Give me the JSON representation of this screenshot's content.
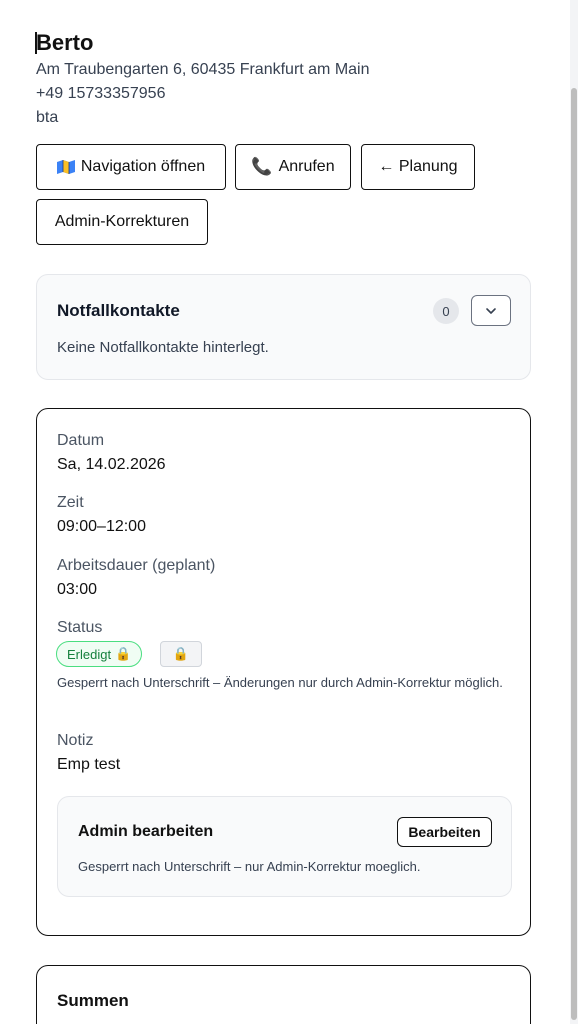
{
  "customer": {
    "name": "Berto",
    "address": "Am Traubengarten 6, 60435 Frankfurt am Main",
    "phone": "+49 15733357956",
    "code": "bta"
  },
  "actions": {
    "navigation_label": "Navigation öffnen",
    "call_label": "Anrufen",
    "planning_label": "← Planung",
    "admin_corrections_label": "Admin-Korrekturen"
  },
  "emergency": {
    "title": "Notfallkontakte",
    "count": "0",
    "empty_text": "Keine Notfallkontakte hinterlegt."
  },
  "details": {
    "date_label": "Datum",
    "date_value": "Sa, 14.02.2026",
    "time_label": "Zeit",
    "time_value": "09:00–12:00",
    "duration_label": "Arbeitsdauer (geplant)",
    "duration_value": "03:00",
    "status_label": "Status",
    "status_value": "Erledigt",
    "lock_note": "Gesperrt nach Unterschrift – Änderungen nur durch Admin-Korrektur möglich.",
    "note_label": "Notiz",
    "note_value": "Emp test"
  },
  "admin_edit": {
    "title": "Admin bearbeiten",
    "button_label": "Bearbeiten",
    "note": "Gesperrt nach Unterschrift – nur Admin-Korrektur moeglich."
  },
  "summary": {
    "title": "Summen"
  },
  "icons": {
    "navigation": "map-icon",
    "call": "phone-icon",
    "lock": "lock-icon",
    "toggle": "chevron-down-icon"
  },
  "colors": {
    "status_green": "#15803d",
    "status_bg": "#f0fdf4",
    "call_icon": "#db2777"
  }
}
